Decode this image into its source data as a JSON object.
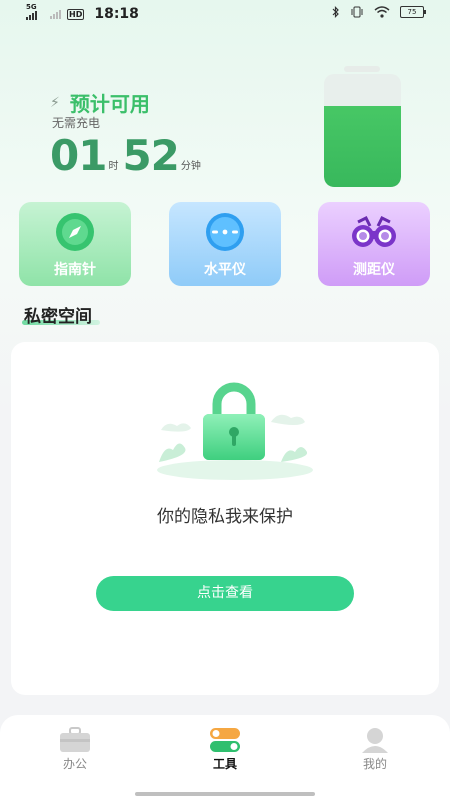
{
  "status_bar": {
    "network": "5G",
    "hd": "HD",
    "time": "18:18",
    "battery_level": "75"
  },
  "battery": {
    "title": "预计可用",
    "subtitle": "无需充电",
    "hours": "01",
    "hours_unit": "时",
    "minutes": "52",
    "minutes_unit": "分钟",
    "fill_fraction": 0.72,
    "accent_color": "#3bbf6a"
  },
  "tools": [
    {
      "label": "指南针",
      "icon": "compass-icon",
      "color": "#8fe3a8"
    },
    {
      "label": "水平仪",
      "icon": "level-icon",
      "color": "#8fcbf8"
    },
    {
      "label": "测距仪",
      "icon": "binoculars-icon",
      "color": "#cf9cf7"
    }
  ],
  "private_space": {
    "title": "私密空间",
    "message": "你的隐私我来保护",
    "button_label": "点击查看",
    "button_color": "#37d38e"
  },
  "bottom_nav": {
    "items": [
      {
        "label": "办公",
        "icon": "briefcase-icon",
        "active": false
      },
      {
        "label": "工具",
        "icon": "toggle-tools-icon",
        "active": true
      },
      {
        "label": "我的",
        "icon": "user-icon",
        "active": false
      }
    ]
  }
}
